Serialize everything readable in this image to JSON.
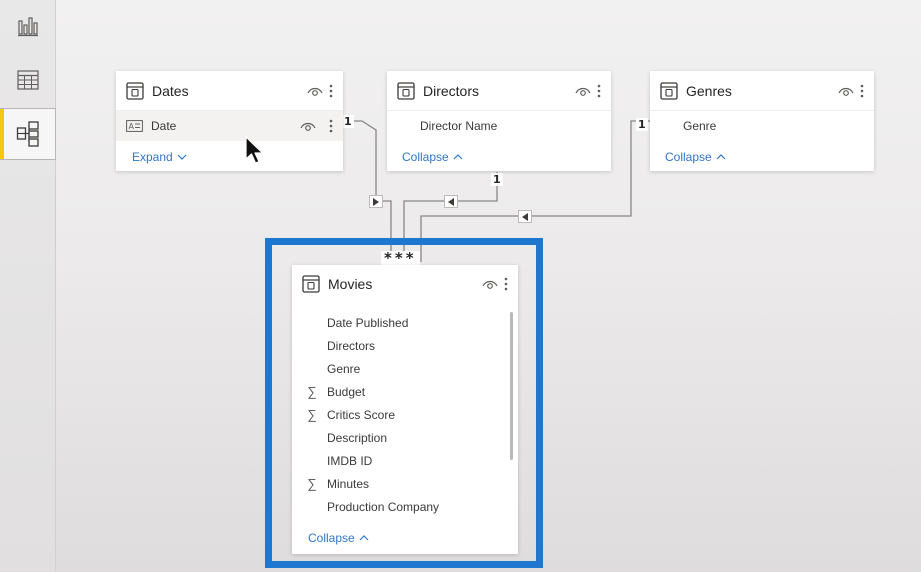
{
  "rail": {
    "items": [
      {
        "name": "report-view",
        "icon": "bar-chart-icon"
      },
      {
        "name": "data-view",
        "icon": "table-icon"
      },
      {
        "name": "model-view",
        "icon": "model-diagram-icon",
        "active": true
      }
    ]
  },
  "tables": {
    "dates": {
      "title": "Dates",
      "fields": [
        {
          "label": "Date"
        }
      ],
      "toggle_label": "Expand"
    },
    "directors": {
      "title": "Directors",
      "fields": [
        {
          "label": "Director Name"
        }
      ],
      "toggle_label": "Collapse"
    },
    "genres": {
      "title": "Genres",
      "fields": [
        {
          "label": "Genre"
        }
      ],
      "toggle_label": "Collapse"
    },
    "movies": {
      "title": "Movies",
      "fields": [
        {
          "label": "Date Published",
          "sigma": ""
        },
        {
          "label": "Directors",
          "sigma": ""
        },
        {
          "label": "Genre",
          "sigma": ""
        },
        {
          "label": "Budget",
          "sigma": "∑"
        },
        {
          "label": "Critics Score",
          "sigma": "∑"
        },
        {
          "label": "Description",
          "sigma": ""
        },
        {
          "label": "IMDB ID",
          "sigma": ""
        },
        {
          "label": "Minutes",
          "sigma": "∑"
        },
        {
          "label": "Production Company",
          "sigma": ""
        }
      ],
      "toggle_label": "Collapse"
    }
  },
  "relationships": {
    "one_label": "1",
    "many_label": "***"
  },
  "colors": {
    "accent_link": "#2f77c8",
    "highlight_border": "#1e78d0",
    "active_rail_marker": "#f2c811"
  }
}
